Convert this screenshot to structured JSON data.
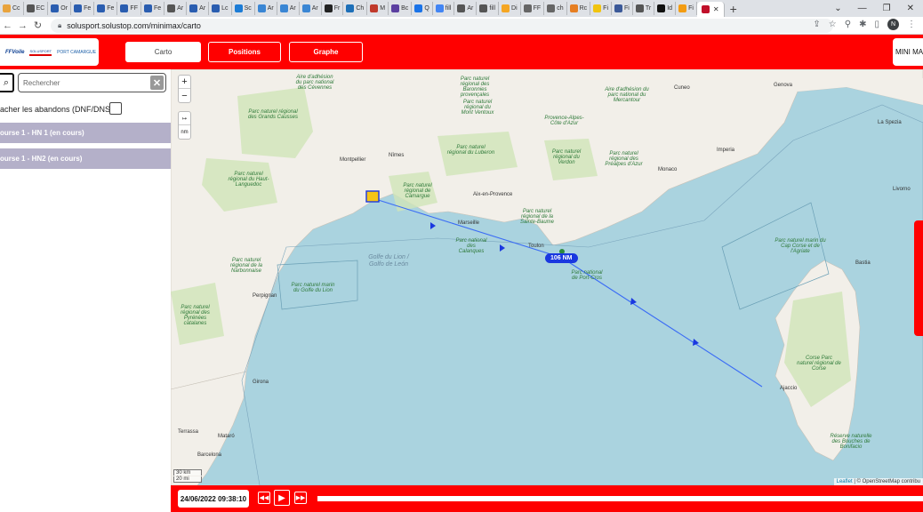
{
  "browser": {
    "tabs": [
      {
        "label": "Cc",
        "color": "#e8a33d"
      },
      {
        "label": "EC",
        "color": "#555"
      },
      {
        "label": "Or",
        "color": "#2a5db0"
      },
      {
        "label": "Fe",
        "color": "#2a5db0"
      },
      {
        "label": "Fe",
        "color": "#2a5db0"
      },
      {
        "label": "FF",
        "color": "#2a5db0"
      },
      {
        "label": "Fe",
        "color": "#2a5db0"
      },
      {
        "label": "Ar",
        "color": "#555"
      },
      {
        "label": "Ar",
        "color": "#2a5db0"
      },
      {
        "label": "Lc",
        "color": "#2a5db0"
      },
      {
        "label": "Sc",
        "color": "#1c7cd6"
      },
      {
        "label": "Ar",
        "color": "#3a86d4"
      },
      {
        "label": "Ar",
        "color": "#3a86d4"
      },
      {
        "label": "Ar",
        "color": "#3a86d4"
      },
      {
        "label": "Fr",
        "color": "#222"
      },
      {
        "label": "Ch",
        "color": "#1d6fb8"
      },
      {
        "label": "M",
        "color": "#c0392b"
      },
      {
        "label": "Bc",
        "color": "#5b3fa0"
      },
      {
        "label": "Q",
        "color": "#1a73e8"
      },
      {
        "label": "fill",
        "color": "#4285f4"
      },
      {
        "label": "Ar",
        "color": "#555"
      },
      {
        "label": "fill",
        "color": "#555"
      },
      {
        "label": "Di",
        "color": "#f5a623"
      },
      {
        "label": "FF",
        "color": "#666"
      },
      {
        "label": "ch",
        "color": "#666"
      },
      {
        "label": "Rc",
        "color": "#e67e22"
      },
      {
        "label": "Fi",
        "color": "#f1c40f"
      },
      {
        "label": "Fi",
        "color": "#3b5998"
      },
      {
        "label": "Tr",
        "color": "#555"
      },
      {
        "label": "Id",
        "color": "#111"
      },
      {
        "label": "Fi",
        "color": "#f39c12"
      }
    ],
    "active_tab_color": "#c0102a",
    "new_tab": "+",
    "url": "solusport.solustop.com/minimax/carto",
    "profile_initial": "N"
  },
  "header": {
    "logo_ffv": "FFVoile",
    "logo_solusport": "SOLUSPORT",
    "logo_port": "PORT CAMARGUE",
    "nav": {
      "carto": "Carto",
      "positions": "Positions",
      "graphe": "Graphe"
    },
    "brand": "MINI MAX"
  },
  "sidebar": {
    "search_placeholder": "Rechercher",
    "clear_icon": "✕",
    "abandon_label": "acher les abandons (DNF/DNS)",
    "races": [
      {
        "label": "ourse 1 - HN 1 (en cours)"
      },
      {
        "label": "ourse 1 - HN2 (en cours)"
      }
    ]
  },
  "map": {
    "zoom_in": "+",
    "zoom_out": "−",
    "measure_arrow": "↦",
    "measure_unit": "nm",
    "distance_label": "106 NM",
    "scale_km": "30 km",
    "scale_mi": "20 mi",
    "attribution_leaflet": "Leaflet",
    "attribution_osm": "| © OpenStreetMap contribu",
    "sea_labels": [
      "Golfe du Lion / Golfo de León"
    ],
    "cities": {
      "montpellier": "Montpellier",
      "nimes": "Nîmes",
      "marseille": "Marseille",
      "toulon": "Toulon",
      "aix": "Aix-en-Provence",
      "monaco": "Monaco",
      "genova": "Genova",
      "cuneo": "Cuneo",
      "perpignan": "Perpignan",
      "girona": "Girona",
      "barcelona": "Barcelona",
      "terrassa": "Terrassa",
      "mataro": "Mataró",
      "ajaccio": "Ajaccio",
      "imperia": "Imperia",
      "la_spezia": "La Spezia",
      "livorno": "Livorno",
      "bastia": "Bastia"
    },
    "parks": {
      "grands_causses": "Parc naturel régional des Grands Causses",
      "haut_languedoc": "Parc naturel régional du Haut-Languedoc",
      "camargue": "Parc naturel régional de Camargue",
      "luberon": "Parc naturel régional du Luberon",
      "verdon": "Parc naturel régional du Verdon",
      "alpes_cote": "Provence-Alpes-Côte d'Azur",
      "corse": "Corse Parc naturel régional de Corse",
      "cap_corse": "Parc naturel marin du Cap Corse et de l'Agriate",
      "golfe_lion": "Parc naturel marin du Golfe du Lion",
      "narbonnaise": "Parc naturel régional de la Narbonnaise",
      "pyrenees": "Parc naturel régional des Pyrénées catalanes",
      "cevennes": "Aire d'adhésion du parc national des Cévennes",
      "port_cros": "Parc national de Port-Cros",
      "calanques": "Parc national des Calanques",
      "sainte_baume": "Parc naturel régional de la Sainte-Baume",
      "prealpes": "Parc naturel régional des Préalpes d'Azur",
      "ventoux": "Parc naturel régional du Mont Ventoux",
      "baronnies": "Parc naturel régional des Baronnies provençales",
      "mercantour": "Aire d'adhésion du parc national du Mercantour",
      "bouches": "Réserve naturelle des Bouches de Bonifacio"
    },
    "colors": {
      "sea": "#aad3df",
      "land": "#f2efe9",
      "track": "#3b6cf5",
      "park": "#cfe5b8"
    }
  },
  "timeline": {
    "datetime": "24/06/2022 09:38:10",
    "rewind": "◀◀",
    "play": "▶",
    "forward": "▶▶"
  }
}
